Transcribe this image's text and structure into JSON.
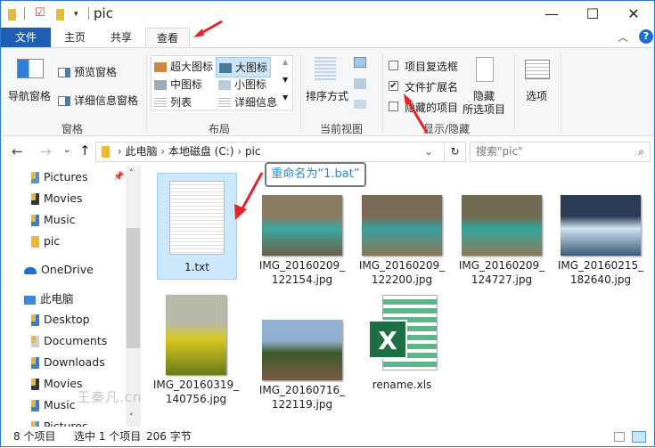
{
  "window": {
    "title": "pic",
    "minimize": "—",
    "maximize": "☐",
    "close": "✕"
  },
  "tabs": [
    {
      "label": "文件"
    },
    {
      "label": "主页"
    },
    {
      "label": "共享"
    },
    {
      "label": "查看"
    }
  ],
  "ribbon": {
    "panes": {
      "nav_pane": "导航窗格",
      "preview_pane": "预览窗格",
      "details_pane": "详细信息窗格",
      "group": "窗格"
    },
    "layout": {
      "items": [
        "超大图标",
        "大图标",
        "中图标",
        "小图标",
        "列表",
        "详细信息"
      ],
      "selected": "大图标",
      "group": "布局"
    },
    "current_view": {
      "sort": "排序方式",
      "group": "当前视图"
    },
    "show_hide": {
      "item_checkboxes": {
        "label": "项目复选框",
        "checked": false
      },
      "file_extensions": {
        "label": "文件扩展名",
        "checked": true
      },
      "hidden_items": {
        "label": "隐藏的项目",
        "checked": false
      },
      "hide_selected_1": "隐藏",
      "hide_selected_2": "所选项目",
      "group": "显示/隐藏"
    },
    "options": "选项"
  },
  "nav": {
    "breadcrumb": [
      "此电脑",
      "本地磁盘 (C:)",
      "pic"
    ],
    "search_placeholder": "搜索\"pic\""
  },
  "sidebar": [
    {
      "label": "Pictures",
      "indent": 1
    },
    {
      "label": "Movies",
      "indent": 1
    },
    {
      "label": "Music",
      "indent": 1
    },
    {
      "label": "pic",
      "indent": 1
    },
    {
      "label": "OneDrive",
      "indent": 0
    },
    {
      "label": "此电脑",
      "indent": 0
    },
    {
      "label": "Desktop",
      "indent": 1
    },
    {
      "label": "Documents",
      "indent": 1
    },
    {
      "label": "Downloads",
      "indent": 1
    },
    {
      "label": "Movies",
      "indent": 1
    },
    {
      "label": "Music",
      "indent": 1
    },
    {
      "label": "Pictures",
      "indent": 1
    }
  ],
  "files": [
    {
      "l1": "1.txt",
      "l2": "",
      "type": "txt",
      "selected": true
    },
    {
      "l1": "IMG_20160209_",
      "l2": "122154.jpg",
      "type": "jpg",
      "colors": [
        "#8a7a5f",
        "#3aa8a0",
        "#6d5f4a"
      ]
    },
    {
      "l1": "IMG_20160209_",
      "l2": "122200.jpg",
      "type": "jpg",
      "colors": [
        "#7a6a55",
        "#3aa0a0",
        "#8a7656"
      ]
    },
    {
      "l1": "IMG_20160209_",
      "l2": "124727.jpg",
      "type": "jpg",
      "colors": [
        "#6f6a50",
        "#36a59b",
        "#8a7a58"
      ]
    },
    {
      "l1": "IMG_20160215_",
      "l2": "182640.jpg",
      "type": "jpg",
      "colors": [
        "#2a3d55",
        "#cfe3f0",
        "#3d5a78"
      ]
    },
    {
      "l1": "IMG_20160319_",
      "l2": "140756.jpg",
      "type": "jpg",
      "colors": [
        "#b9b9a8",
        "#d8c820",
        "#6a7a1a"
      ]
    },
    {
      "l1": "IMG_20160716_",
      "l2": "122119.jpg",
      "type": "jpg",
      "colors": [
        "#8fb0d0",
        "#3a5a2a",
        "#7a5a48"
      ]
    },
    {
      "l1": "rename.xls",
      "l2": "",
      "type": "xls"
    }
  ],
  "annotation": "重命名为“1.bat”",
  "watermark": "王秦凡.cn",
  "status": {
    "count": "8 个项目",
    "selected": "选中 1 个项目",
    "size": "206 字节"
  }
}
